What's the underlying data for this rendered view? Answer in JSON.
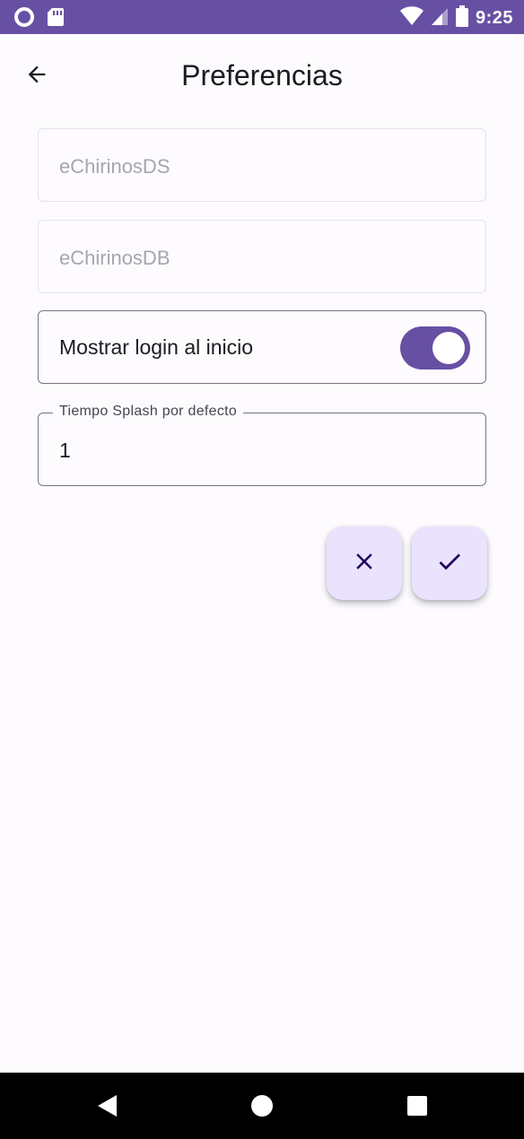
{
  "status_bar": {
    "time": "9:25",
    "icons": [
      "circle-notification-icon",
      "sd-card-icon",
      "wifi-icon",
      "signal-icon",
      "battery-icon"
    ],
    "background": "#6750a4"
  },
  "app_bar": {
    "title": "Preferencias",
    "back_icon": "arrow-back-icon"
  },
  "form": {
    "field_ds": {
      "value": "eChirinosDS",
      "disabled": true
    },
    "field_db": {
      "value": "eChirinosDB",
      "disabled": true
    },
    "login_switch": {
      "label": "Mostrar login al inicio",
      "checked": true
    },
    "splash_time": {
      "label": "Tiempo Splash por defecto",
      "value": "1"
    }
  },
  "actions": {
    "cancel_icon": "close-icon",
    "confirm_icon": "check-icon"
  },
  "nav_bar": {
    "items": [
      "back-triangle-icon",
      "home-circle-icon",
      "recents-square-icon"
    ]
  },
  "colors": {
    "primary": "#6750a4",
    "fab_background": "#eae3fd",
    "fab_icon": "#21005d",
    "background": "#fdfbfe"
  }
}
